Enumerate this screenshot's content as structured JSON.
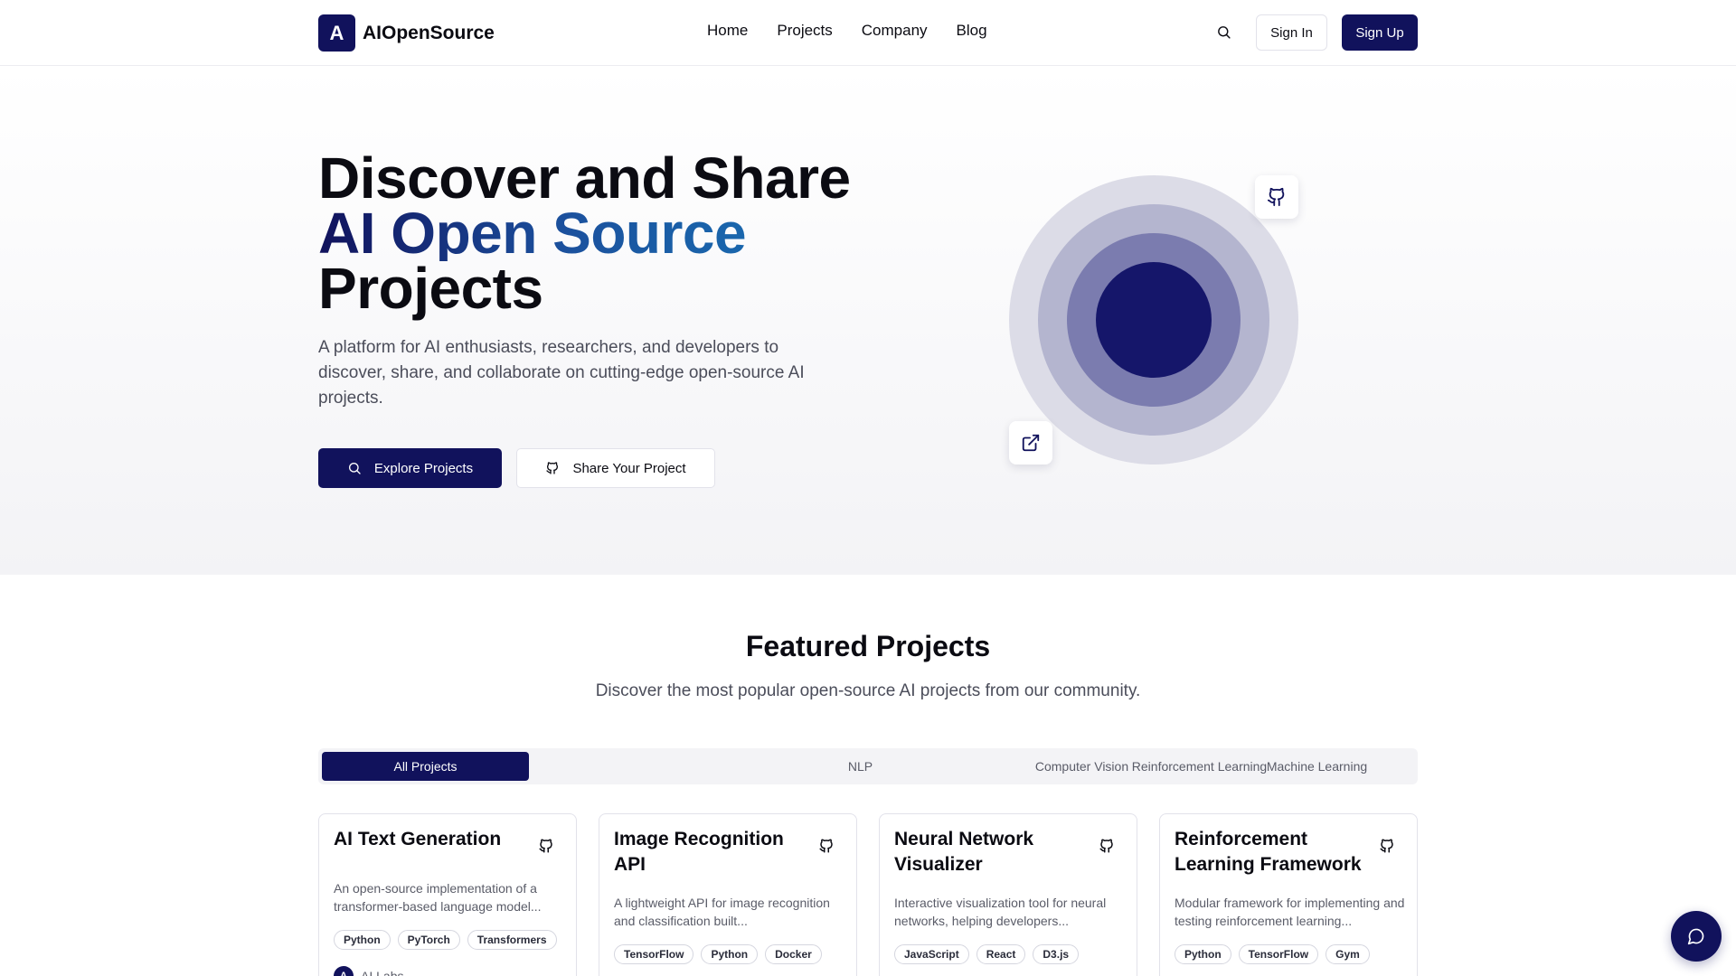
{
  "brand": {
    "logo_letter": "A",
    "name": "AIOpenSource",
    "accent": "#11125c"
  },
  "nav": {
    "items": [
      "Home",
      "Projects",
      "Company",
      "Blog"
    ]
  },
  "header": {
    "search_icon": "search-icon",
    "signin_label": "Sign In",
    "signup_label": "Sign Up"
  },
  "hero": {
    "title_line1": "Discover and Share",
    "title_line2": "AI Open Source",
    "title_line3": "Projects",
    "description": "A platform for AI enthusiasts, researchers, and developers to discover, share, and collaborate on cutting-edge open-source AI projects.",
    "explore_label": "Explore Projects",
    "share_label": "Share Your Project"
  },
  "featured": {
    "title": "Featured Projects",
    "subtitle": "Discover the most popular open-source AI projects from our community.",
    "tabs": [
      {
        "label": "All Projects",
        "active": true
      },
      {
        "label": "NLP",
        "active": false
      },
      {
        "label": "Computer Vision",
        "active": false
      },
      {
        "label": "Reinforcement Learning",
        "active": false
      },
      {
        "label": "Machine Learning",
        "active": false
      }
    ],
    "cards": [
      {
        "title": "AI Text Generation",
        "description": "An open-source implementation of a transformer-based language model...",
        "tags": [
          "Python",
          "PyTorch",
          "Transformers"
        ],
        "author": "AI Labs",
        "author_initial": "A"
      },
      {
        "title": "Image Recognition API",
        "description": "A lightweight API for image recognition and classification built...",
        "tags": [
          "TensorFlow",
          "Python",
          "Docker"
        ]
      },
      {
        "title": "Neural Network Visualizer",
        "description": "Interactive visualization tool for neural networks, helping developers...",
        "tags": [
          "JavaScript",
          "React",
          "D3.js"
        ]
      },
      {
        "title": "Reinforcement Learning Framework",
        "description": "Modular framework for implementing and testing reinforcement learning...",
        "tags": [
          "Python",
          "TensorFlow",
          "Gym"
        ]
      }
    ]
  },
  "chat": {
    "icon": "chat-icon"
  }
}
